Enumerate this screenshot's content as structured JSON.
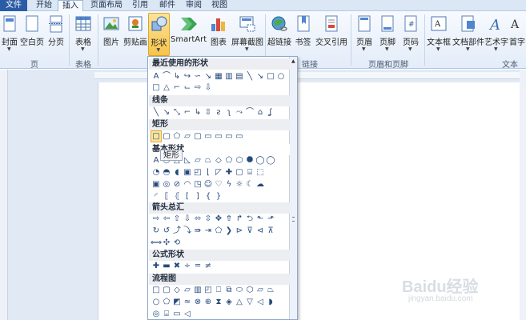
{
  "tabs": {
    "file": "文件",
    "start": "开始",
    "insert": "插入",
    "layout": "页面布局",
    "ref": "引用",
    "mail": "邮件",
    "review": "审阅",
    "view": "视图"
  },
  "ribbon": {
    "cover": "封面",
    "blank": "空白页",
    "pagebreak": "分页",
    "table": "表格",
    "picture": "图片",
    "clipart": "剪贴画",
    "shapes": "形状",
    "smartart": "SmartArt",
    "chart": "图表",
    "screenshot": "屏幕截图",
    "hyperlink": "超链接",
    "bookmark": "书签",
    "crossref": "交叉引用",
    "header": "页眉",
    "footer": "页脚",
    "pagenum": "页码",
    "textbox": "文本框",
    "quickparts": "文档部件",
    "wordart": "艺术字",
    "dropcap": "首字"
  },
  "groups": {
    "pages": "页",
    "tables": "表格",
    "links": "链接",
    "headerfooter": "页眉和页脚",
    "text": "文本"
  },
  "panel": {
    "recent": "最近使用的形状",
    "lines": "线条",
    "rect": "矩形",
    "basic": "基本形状",
    "arrows": "箭头总汇",
    "equation": "公式形状",
    "flowchart": "流程图"
  },
  "tooltip": "矩形",
  "watermark": {
    "main": "Baidu经验",
    "sub": "jingyan.baidu.com"
  }
}
